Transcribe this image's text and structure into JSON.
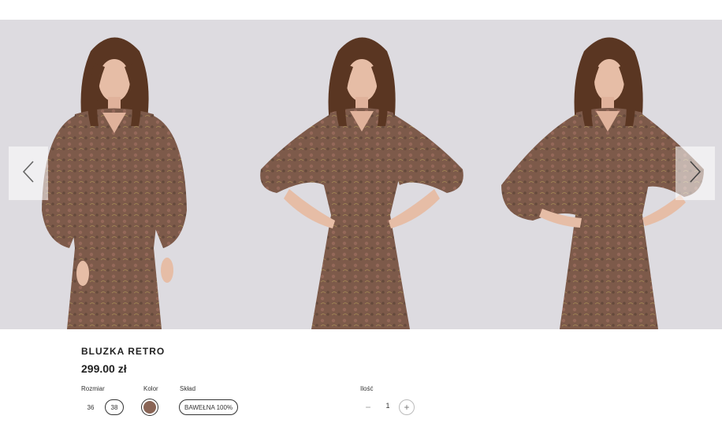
{
  "product": {
    "name": "BLUZKA RETRO",
    "price": "299.00 zł"
  },
  "options": {
    "size_label": "Rozmiar",
    "sizes": [
      "36",
      "38"
    ],
    "selected_size": "38",
    "color_label": "Kolor",
    "color_swatch": "#8a6556",
    "composition_label": "Skład",
    "composition_value": "BAWEŁNA 100%",
    "quantity_label": "Ilość",
    "quantity": "1"
  },
  "gallery": {
    "prev_icon": "chevron-left-icon",
    "next_icon": "chevron-right-icon",
    "background": "#dddbe0",
    "dress_color": "#7d5a4a",
    "hair_color": "#5a3622",
    "skin_color": "#e6bda6"
  }
}
